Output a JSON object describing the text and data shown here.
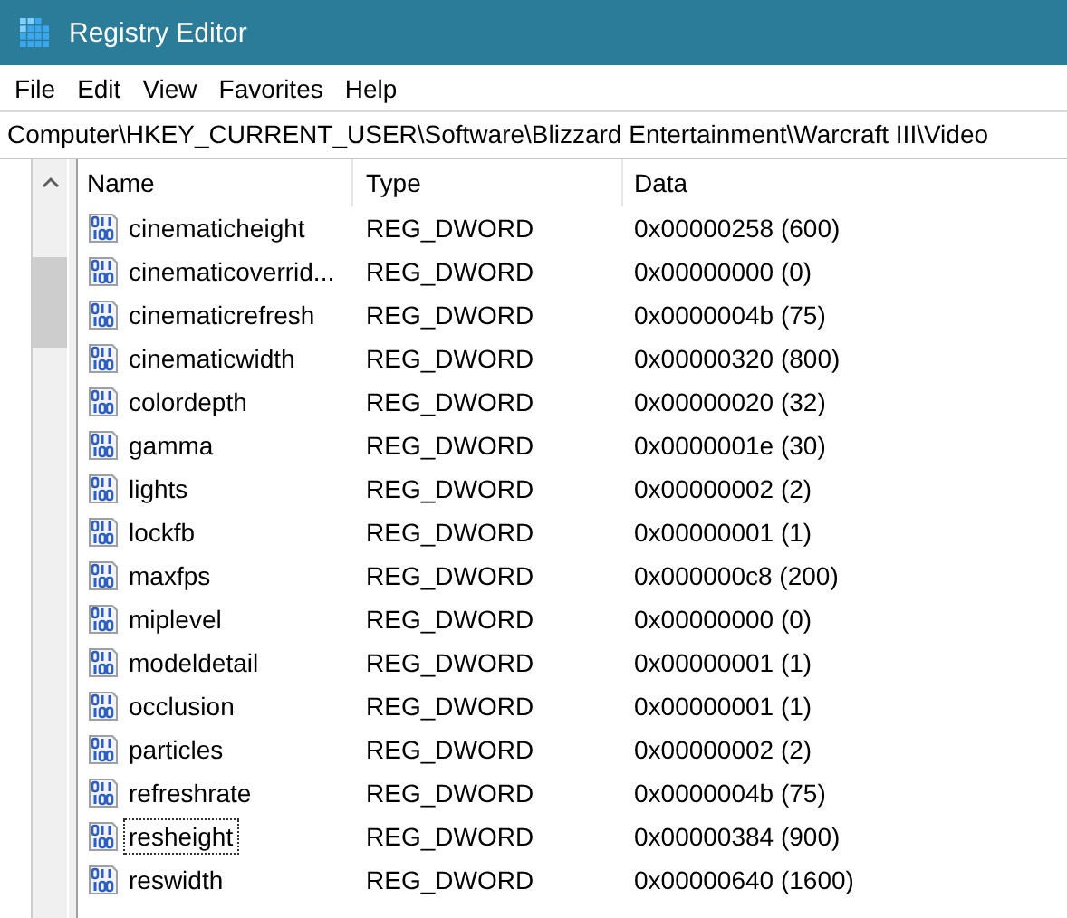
{
  "window": {
    "title": "Registry Editor"
  },
  "menu": [
    "File",
    "Edit",
    "View",
    "Favorites",
    "Help"
  ],
  "address": "Computer\\HKEY_CURRENT_USER\\Software\\Blizzard Entertainment\\Warcraft III\\Video",
  "table": {
    "columns": [
      "Name",
      "Type",
      "Data"
    ],
    "rows": [
      {
        "name": "cinematicheight",
        "type": "REG_DWORD",
        "data": "0x00000258 (600)",
        "focused": false
      },
      {
        "name": "cinematicoverrid...",
        "type": "REG_DWORD",
        "data": "0x00000000 (0)",
        "focused": false
      },
      {
        "name": "cinematicrefresh",
        "type": "REG_DWORD",
        "data": "0x0000004b (75)",
        "focused": false
      },
      {
        "name": "cinematicwidth",
        "type": "REG_DWORD",
        "data": "0x00000320 (800)",
        "focused": false
      },
      {
        "name": "colordepth",
        "type": "REG_DWORD",
        "data": "0x00000020 (32)",
        "focused": false
      },
      {
        "name": "gamma",
        "type": "REG_DWORD",
        "data": "0x0000001e (30)",
        "focused": false
      },
      {
        "name": "lights",
        "type": "REG_DWORD",
        "data": "0x00000002 (2)",
        "focused": false
      },
      {
        "name": "lockfb",
        "type": "REG_DWORD",
        "data": "0x00000001 (1)",
        "focused": false
      },
      {
        "name": "maxfps",
        "type": "REG_DWORD",
        "data": "0x000000c8 (200)",
        "focused": false
      },
      {
        "name": "miplevel",
        "type": "REG_DWORD",
        "data": "0x00000000 (0)",
        "focused": false
      },
      {
        "name": "modeldetail",
        "type": "REG_DWORD",
        "data": "0x00000001 (1)",
        "focused": false
      },
      {
        "name": "occlusion",
        "type": "REG_DWORD",
        "data": "0x00000001 (1)",
        "focused": false
      },
      {
        "name": "particles",
        "type": "REG_DWORD",
        "data": "0x00000002 (2)",
        "focused": false
      },
      {
        "name": "refreshrate",
        "type": "REG_DWORD",
        "data": "0x0000004b (75)",
        "focused": false
      },
      {
        "name": "resheight",
        "type": "REG_DWORD",
        "data": "0x00000384 (900)",
        "focused": true
      },
      {
        "name": "reswidth",
        "type": "REG_DWORD",
        "data": "0x00000640 (1600)",
        "focused": false
      }
    ]
  }
}
